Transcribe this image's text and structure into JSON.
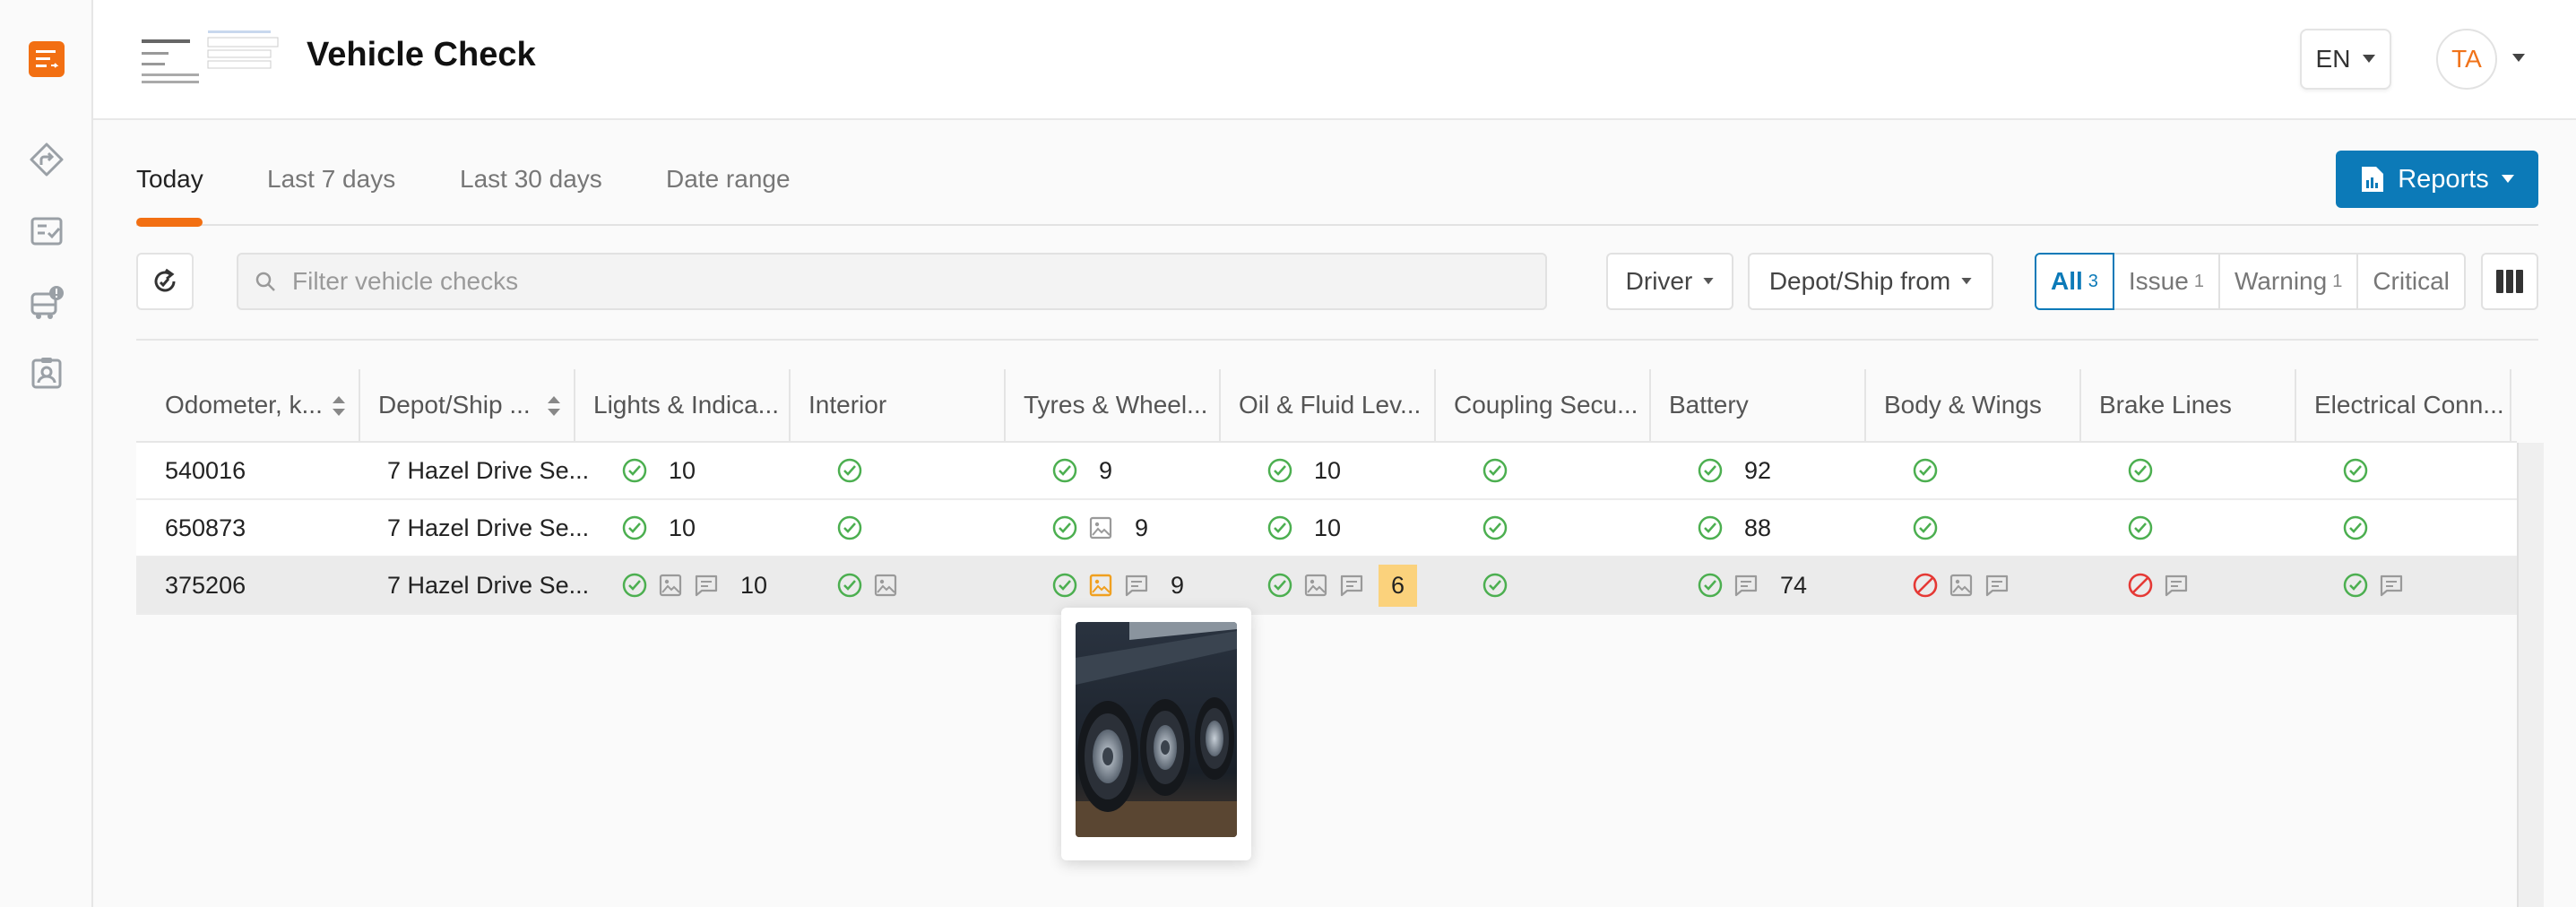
{
  "header": {
    "title": "Vehicle Check",
    "language": "EN",
    "user_initials": "TA"
  },
  "tabs": [
    {
      "label": "Today",
      "active": true
    },
    {
      "label": "Last 7 days",
      "active": false
    },
    {
      "label": "Last 30 days",
      "active": false
    },
    {
      "label": "Date range",
      "active": false
    }
  ],
  "reports_label": "Reports",
  "search": {
    "placeholder": "Filter vehicle checks"
  },
  "filters": {
    "driver": "Driver",
    "depot": "Depot/Ship from"
  },
  "segments": [
    {
      "label": "All",
      "count": "3",
      "active": true
    },
    {
      "label": "Issue",
      "count": "1"
    },
    {
      "label": "Warning",
      "count": "1"
    },
    {
      "label": "Critical",
      "count": ""
    }
  ],
  "columns": [
    "Odometer, k...",
    "Depot/Ship ...",
    "Lights & Indica...",
    "Interior",
    "Tyres & Wheel...",
    "Oil & Fluid Lev...",
    "Coupling Secu...",
    "Battery",
    "Body & Wings",
    "Brake Lines",
    "Electrical Conn..."
  ],
  "rows": [
    {
      "odometer": "540016",
      "depot": "7 Hazel Drive Se...",
      "lights": "10",
      "tyres": "9",
      "oil": "10",
      "battery": "92"
    },
    {
      "odometer": "650873",
      "depot": "7 Hazel Drive Se...",
      "lights": "10",
      "tyres": "9",
      "oil": "10",
      "battery": "88"
    },
    {
      "odometer": "375206",
      "depot": "7 Hazel Drive Se...",
      "lights": "10",
      "tyres": "9",
      "oil": "6",
      "battery": "74"
    }
  ],
  "colors": {
    "accent": "#f26f12",
    "primary": "#0c7ab8",
    "ok": "#4caf50",
    "critical": "#e53935",
    "warning_bg": "#fbd27c"
  }
}
